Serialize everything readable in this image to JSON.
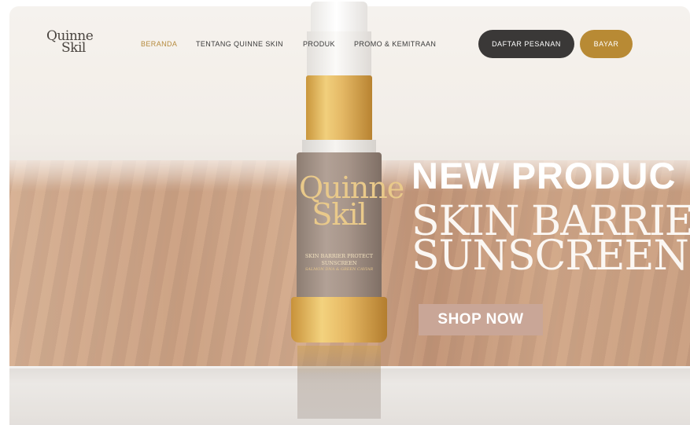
{
  "brand": {
    "logo_line1": "Quinne",
    "logo_line2": "Skil"
  },
  "nav": {
    "items": [
      {
        "label": "BERANDA",
        "active": true
      },
      {
        "label": "TENTANG QUINNE SKIN",
        "active": false
      },
      {
        "label": "PRODUK",
        "active": false
      },
      {
        "label": "PROMO & KEMITRAAN",
        "active": false
      }
    ],
    "order_button": "DAFTAR PESANAN",
    "pay_button": "BAYAR"
  },
  "hero": {
    "headline": "NEW PRODUC",
    "title_line1": "SKIN BARRIEF",
    "title_line2": "SUNSCREEN",
    "cta": "SHOP NOW"
  },
  "product": {
    "logo_line1": "Quinne",
    "logo_line2": "Skil",
    "label_line1": "SKIN BARRIER PROTECT",
    "label_line2": "SUNSCREEN",
    "label_line3": "SALMON DNA & GREEN CAVIAR"
  },
  "colors": {
    "accent_gold": "#b88a34",
    "active_nav": "#b68b3e",
    "dark_button": "#3a3837",
    "cta_background": "#c9a697"
  }
}
